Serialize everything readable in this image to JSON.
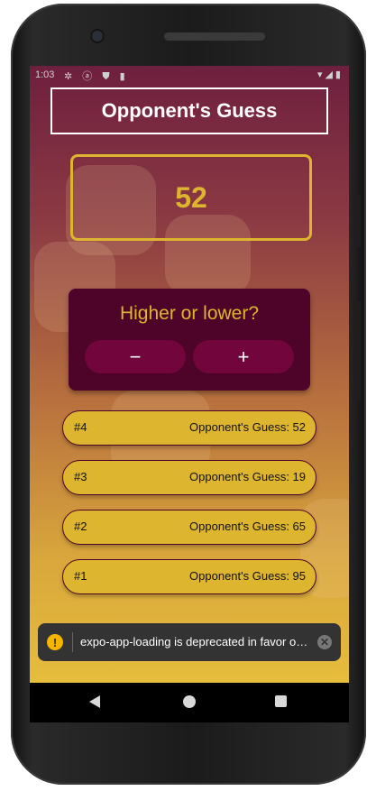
{
  "status_bar": {
    "time": "1:03",
    "left_icons": "✲ ⓐ ⛊ ▮",
    "right_icons": "▾◢▮"
  },
  "header": {
    "title": "Opponent's Guess"
  },
  "current_guess": "52",
  "prompt_card": {
    "title": "Higher or lower?",
    "lower_label": "−",
    "higher_label": "+"
  },
  "guess_log": [
    {
      "number": "#4",
      "text": "Opponent's Guess: 52"
    },
    {
      "number": "#3",
      "text": "Opponent's Guess: 19"
    },
    {
      "number": "#2",
      "text": "Opponent's Guess: 65"
    },
    {
      "number": "#1",
      "text": "Opponent's Guess: 95"
    }
  ],
  "toast": {
    "icon": "!",
    "message": "expo-app-loading is deprecated in favor of expo-splash-screen",
    "close_label": "✕"
  },
  "colors": {
    "primary_dark": "#4e0329",
    "primary_button": "#72063c",
    "accent_gold": "#ddb52f",
    "gradient_top": "#6e1f3e",
    "gradient_bottom": "#e6bd3c"
  }
}
